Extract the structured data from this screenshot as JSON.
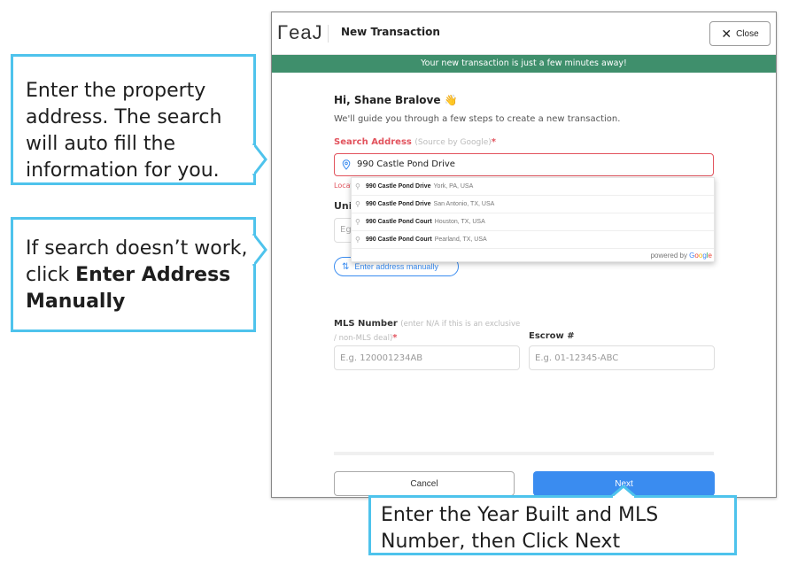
{
  "window": {
    "logo": "ΓeaJ",
    "title": "New Transaction",
    "close_label": "Close"
  },
  "banner": "Your new transaction is just a few minutes away!",
  "form": {
    "greeting": "Hi, Shane Bralove 👋",
    "guide": "We'll guide you through a few steps to create a new transaction.",
    "search_label": "Search Address",
    "search_hint": "(Source by Google)",
    "required_mark": "*",
    "search_value": "990 Castle Pond Drive",
    "loc_error": "Locat",
    "unit_label": "Unit",
    "unit_placeholder": "Eg:",
    "manual_button": "Enter address manually",
    "mls_label": "MLS Number",
    "mls_hint": "(enter N/A if this is an exclusive / non-MLS deal)",
    "mls_placeholder": "E.g. 120001234AB",
    "escrow_label": "Escrow #",
    "escrow_placeholder": "E.g. 01-12345-ABC",
    "cancel_label": "Cancel",
    "next_label": "Next"
  },
  "suggestions": [
    {
      "main": "990 Castle Pond Drive",
      "sub": "York, PA, USA"
    },
    {
      "main": "990 Castle Pond Drive",
      "sub": "San Antonio, TX, USA"
    },
    {
      "main": "990 Castle Pond Court",
      "sub": "Houston, TX, USA"
    },
    {
      "main": "990 Castle Pond Court",
      "sub": "Pearland, TX, USA"
    }
  ],
  "powered": {
    "prefix": "powered by ",
    "g1": "G",
    "g2": "o",
    "g3": "o",
    "g4": "g",
    "g5": "l",
    "g6": "e"
  },
  "callouts": {
    "c1": "Enter the property address. The search will auto fill the information for you.",
    "c2_pre": "If search doesn’t work, click ",
    "c2_bold": "Enter Address Manually",
    "c3": "Enter the Year Built and MLS Number, then Click Next"
  },
  "colors": {
    "accent": "#3a8cf0",
    "banner": "#3f8f6c",
    "error": "#e2535d",
    "callout_border": "#4ec3ec"
  }
}
